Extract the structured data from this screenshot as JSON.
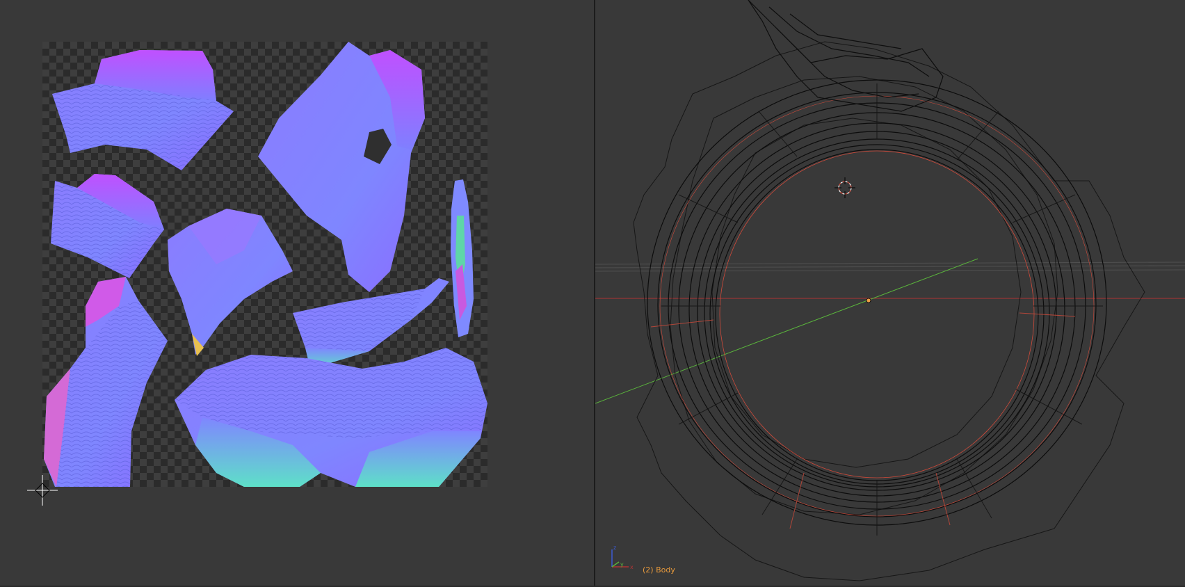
{
  "uv_editor": {
    "image": "normal-map-texture",
    "colors": {
      "background": "#393939",
      "checker_dark": "#2b2b2b",
      "checker_light": "#3e3e3e",
      "normal_base": "#7f7fff",
      "normal_highlight": "#b85cff",
      "normal_edge": "#5ad6c8"
    }
  },
  "viewport": {
    "object_label": "(2) Body",
    "axes": {
      "z": "z",
      "y": "y",
      "x": "x"
    },
    "colors": {
      "wire": "#101010",
      "seam": "#d04a3a",
      "axis_x": "#b03434",
      "axis_y": "#5ab43c",
      "origin": "#f0a044",
      "label": "#e89a3c"
    }
  }
}
